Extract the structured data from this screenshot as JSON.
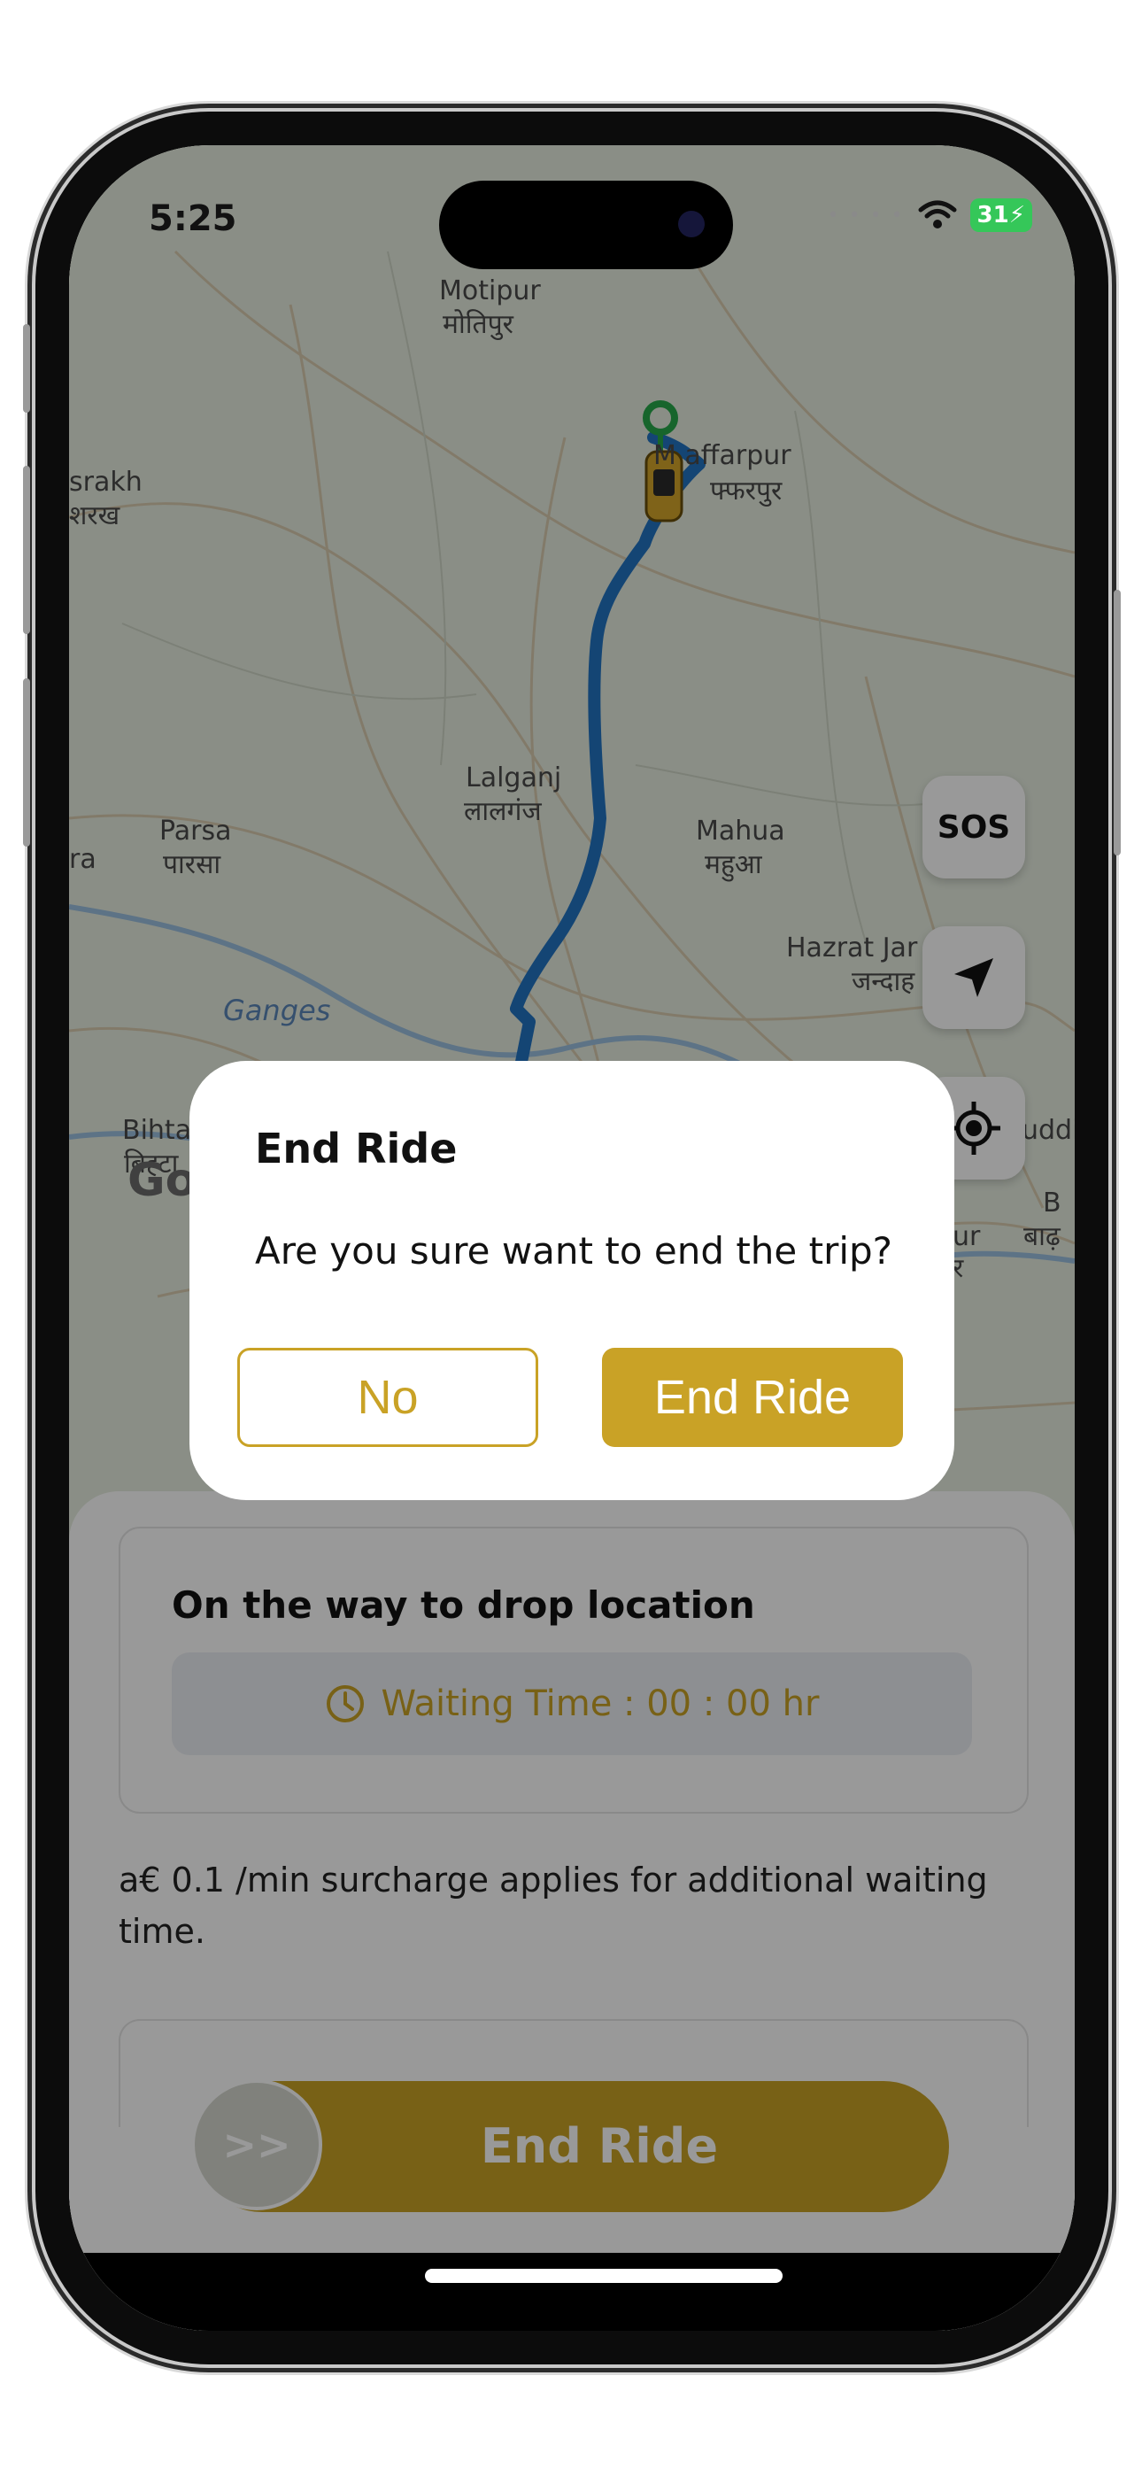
{
  "status_bar": {
    "time": "5:25",
    "battery": "31"
  },
  "map": {
    "labels": [
      {
        "name": "motipur",
        "text": "Motipur"
      },
      {
        "name": "motipur-hi",
        "text": "मोतिपुर"
      },
      {
        "name": "srakh",
        "text": "srakh"
      },
      {
        "name": "srakh-hi",
        "text": "शरख"
      },
      {
        "name": "muzaffarpur",
        "text": "M  affarpur"
      },
      {
        "name": "muzaffarpur-hi",
        "text": "फ्फरपुर"
      },
      {
        "name": "lalganj",
        "text": "Lalganj"
      },
      {
        "name": "lalganj-hi",
        "text": "लालगंज"
      },
      {
        "name": "parsa",
        "text": "Parsa"
      },
      {
        "name": "parsa-hi",
        "text": "पारसा"
      },
      {
        "name": "ra",
        "text": "ra"
      },
      {
        "name": "mahua",
        "text": "Mahua"
      },
      {
        "name": "mahua-hi",
        "text": "महुआ"
      },
      {
        "name": "hazrat",
        "text": "Hazrat Jar"
      },
      {
        "name": "hazrat-hi",
        "text": "जन्दाह"
      },
      {
        "name": "ganges",
        "text": "Ganges"
      },
      {
        "name": "bihta",
        "text": "Bihta"
      },
      {
        "name": "bihta-hi",
        "text": "बिह्टा"
      },
      {
        "name": "uddi",
        "text": "uddi"
      },
      {
        "name": "ur",
        "text": "ur"
      },
      {
        "name": "r",
        "text": "र"
      },
      {
        "name": "b",
        "text": "B"
      },
      {
        "name": "badh",
        "text": "बाढ़"
      },
      {
        "name": "google",
        "text": "Go"
      }
    ],
    "sos_label": "SOS"
  },
  "sheet": {
    "status_title": "On the way to drop location",
    "waiting_time": "Waiting Time : 00 : 00 hr",
    "surcharge_note": "a€ 0.1 /min surcharge applies for additional waiting time.",
    "slider_label": "End Ride",
    "slider_knob": ">>"
  },
  "dialog": {
    "title": "End Ride",
    "message": "Are you sure want to end the trip?",
    "no_label": "No",
    "confirm_label": "End Ride"
  },
  "colors": {
    "accent": "#c9a226",
    "route": "#2273c1",
    "sos_text": "#111111"
  }
}
